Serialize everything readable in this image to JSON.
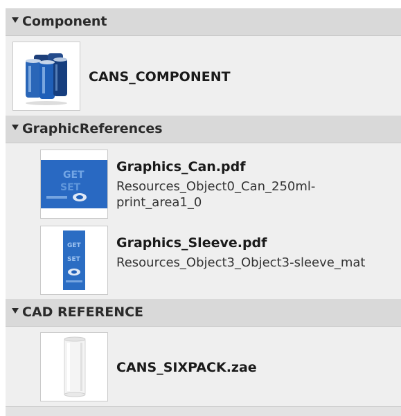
{
  "sections": {
    "component": {
      "header": "Component",
      "item": {
        "name": "CANS_COMPONENT",
        "thumb_icon": "can-pack-icon"
      }
    },
    "graphic_references": {
      "header": "GraphicReferences",
      "items": [
        {
          "name": "Graphics_Can.pdf",
          "subtitle": "Resources_Object0_Can_250ml-print_area1_0",
          "thumb_icon": "can-graphic-icon"
        },
        {
          "name": "Graphics_Sleeve.pdf",
          "subtitle": "Resources_Object3_Object3-sleeve_mat",
          "thumb_icon": "sleeve-graphic-icon"
        }
      ]
    },
    "cad_reference": {
      "header": "CAD REFERENCE",
      "item": {
        "name": "CANS_SIXPACK.zae",
        "thumb_icon": "cad-can-icon"
      }
    }
  },
  "colors": {
    "panel_bg": "#efefef",
    "header_bg": "#d9d9d9",
    "accent_blue": "#1f5fb8"
  }
}
